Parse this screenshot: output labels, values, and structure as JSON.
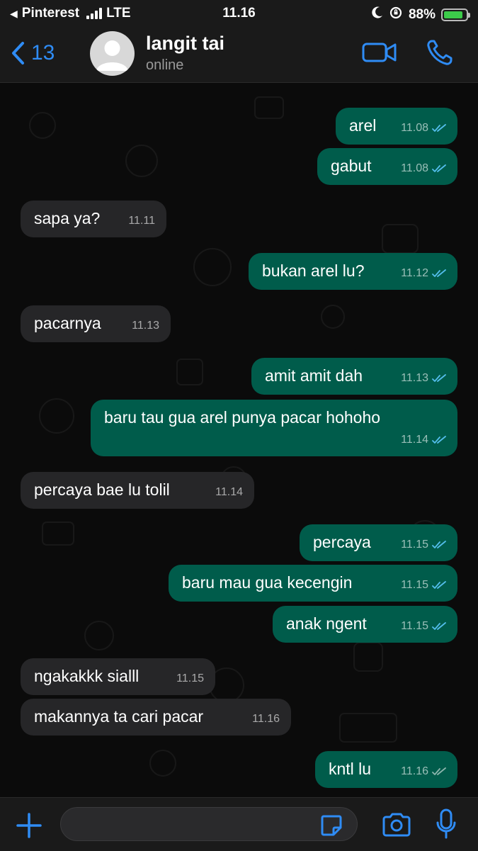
{
  "status_bar": {
    "back_app": "Pinterest",
    "network": "LTE",
    "time": "11.16",
    "battery": "88%",
    "battery_level": 0.88
  },
  "header": {
    "back_count": "13",
    "contact_name": "langit tai",
    "contact_status": "online"
  },
  "colors": {
    "outgoing_bubble": "#005c4b",
    "incoming_bubble": "#262628",
    "accent_blue": "#2f8cf5",
    "read_tick": "#53bdeb"
  },
  "messages": [
    {
      "dir": "out",
      "text": "arel",
      "time": "11.08",
      "status": "read"
    },
    {
      "dir": "out",
      "text": "gabut",
      "time": "11.08",
      "status": "read"
    },
    {
      "dir": "in",
      "text": "sapa ya?",
      "time": "11.11"
    },
    {
      "dir": "out",
      "text": "bukan arel lu?",
      "time": "11.12",
      "status": "read"
    },
    {
      "dir": "in",
      "text": "pacarnya",
      "time": "11.13"
    },
    {
      "dir": "out",
      "text": "amit amit dah",
      "time": "11.13",
      "status": "read"
    },
    {
      "dir": "out",
      "text": "baru tau gua arel punya pacar hohoho",
      "time": "11.14",
      "status": "read"
    },
    {
      "dir": "in",
      "text": "percaya bae lu tolil",
      "time": "11.14"
    },
    {
      "dir": "out",
      "text": "percaya",
      "time": "11.15",
      "status": "read"
    },
    {
      "dir": "out",
      "text": "baru mau gua kecengin",
      "time": "11.15",
      "status": "read"
    },
    {
      "dir": "out",
      "text": "anak ngent",
      "time": "11.15",
      "status": "read"
    },
    {
      "dir": "in",
      "text": "ngakakkk sialll",
      "time": "11.15"
    },
    {
      "dir": "in",
      "text": "makannya ta cari pacar",
      "time": "11.16"
    },
    {
      "dir": "out",
      "text": "kntl lu",
      "time": "11.16",
      "status": "delivered"
    }
  ],
  "composer": {
    "message_value": "",
    "icons": [
      "plus-icon",
      "sticker-icon",
      "camera-icon",
      "microphone-icon"
    ]
  }
}
